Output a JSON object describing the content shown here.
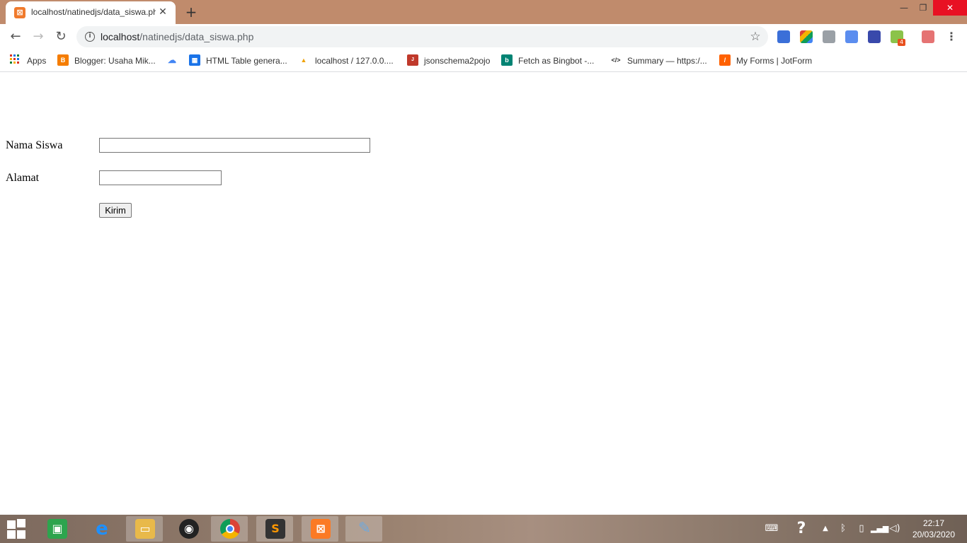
{
  "browser": {
    "tab": {
      "title": "localhost/natinedjs/data_siswa.php",
      "favicon": "xampp-icon"
    },
    "window_controls": [
      "minimize",
      "restore",
      "close"
    ],
    "url_host": "localhost",
    "url_path": "/natinedjs/data_siswa.php",
    "bookmarks": [
      {
        "label": "Apps",
        "icon": "apps-grid-icon"
      },
      {
        "label": "Blogger: Usaha Mik...",
        "icon": "blogger-icon",
        "color": "#f57d00"
      },
      {
        "label": "",
        "icon": "cloud-icon",
        "color": "#4285f4"
      },
      {
        "label": "HTML Table genera...",
        "icon": "table-icon",
        "color": "#1a73e8"
      },
      {
        "label": "localhost / 127.0.0....",
        "icon": "phpmyadmin-icon",
        "color": "#f0a30a"
      },
      {
        "label": "jsonschema2pojo",
        "icon": "json-pojo-icon",
        "color": "#c0392b"
      },
      {
        "label": "Fetch as Bingbot -...",
        "icon": "bing-icon",
        "color": "#008373"
      },
      {
        "label": "Summary — https:/...",
        "icon": "code-icon",
        "color": "#333333"
      },
      {
        "label": "My Forms | JotForm",
        "icon": "jotform-icon",
        "color": "#ff6100"
      }
    ]
  },
  "form": {
    "nama_label": "Nama Siswa",
    "nama_value": "",
    "alamat_label": "Alamat",
    "alamat_value": "",
    "submit_label": "Kirim"
  },
  "taskbar": {
    "apps": [
      {
        "name": "store",
        "color": "#2da44e"
      },
      {
        "name": "internet-explorer",
        "color": "#1e90ff"
      },
      {
        "name": "file-explorer",
        "color": "#e8b94a"
      },
      {
        "name": "camera-app",
        "color": "#222222"
      },
      {
        "name": "chrome",
        "color": "#4285f4"
      },
      {
        "name": "sublime-text",
        "color": "#ff9800"
      },
      {
        "name": "xampp",
        "color": "#fb7a24"
      },
      {
        "name": "paint",
        "color": "#6fa8dc"
      }
    ],
    "time": "22:17",
    "date": "20/03/2020"
  }
}
